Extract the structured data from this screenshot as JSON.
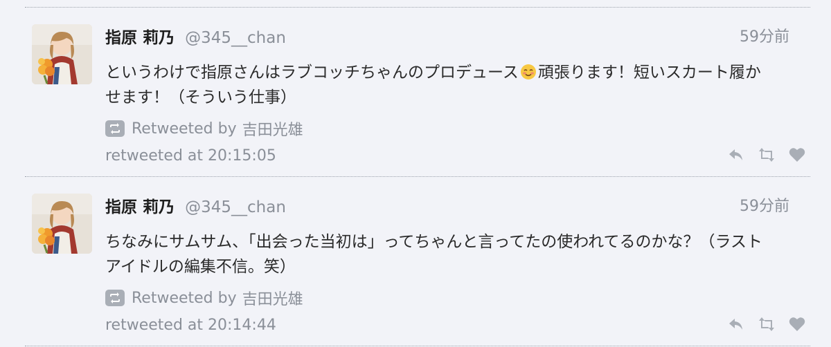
{
  "tweets": [
    {
      "name": "指原 莉乃",
      "handle": "@345__chan",
      "time": "59分前",
      "text_before_emoji": "というわけで指原さんはラブコッチちゃんのプロデュース",
      "emoji": "smiling-face-emoji",
      "text_after_emoji": "頑張ります！短いスカート履かせます！（そういう仕事）",
      "retweet_label": "Retweeted by",
      "retweeter": "吉田光雄",
      "retweeted_at": "retweeted at 20:15:05",
      "actions": [
        "reply-icon",
        "retweet-icon",
        "like-icon"
      ]
    },
    {
      "name": "指原 莉乃",
      "handle": "@345__chan",
      "time": "59分前",
      "text": "ちなみにサムサム、「出会った当初は」ってちゃんと言ってたの使われてるのかな？（ラストアイドルの編集不信。笑）",
      "retweet_label": "Retweeted by",
      "retweeter": "吉田光雄",
      "retweeted_at": "retweeted at 20:14:44",
      "actions": [
        "reply-icon",
        "retweet-icon",
        "like-icon"
      ]
    }
  ],
  "colors": {
    "background": "#f2f3f8",
    "muted_text": "#8a8f98",
    "icon_gray": "#a9aeb6",
    "divider": "#9aa0aa"
  }
}
